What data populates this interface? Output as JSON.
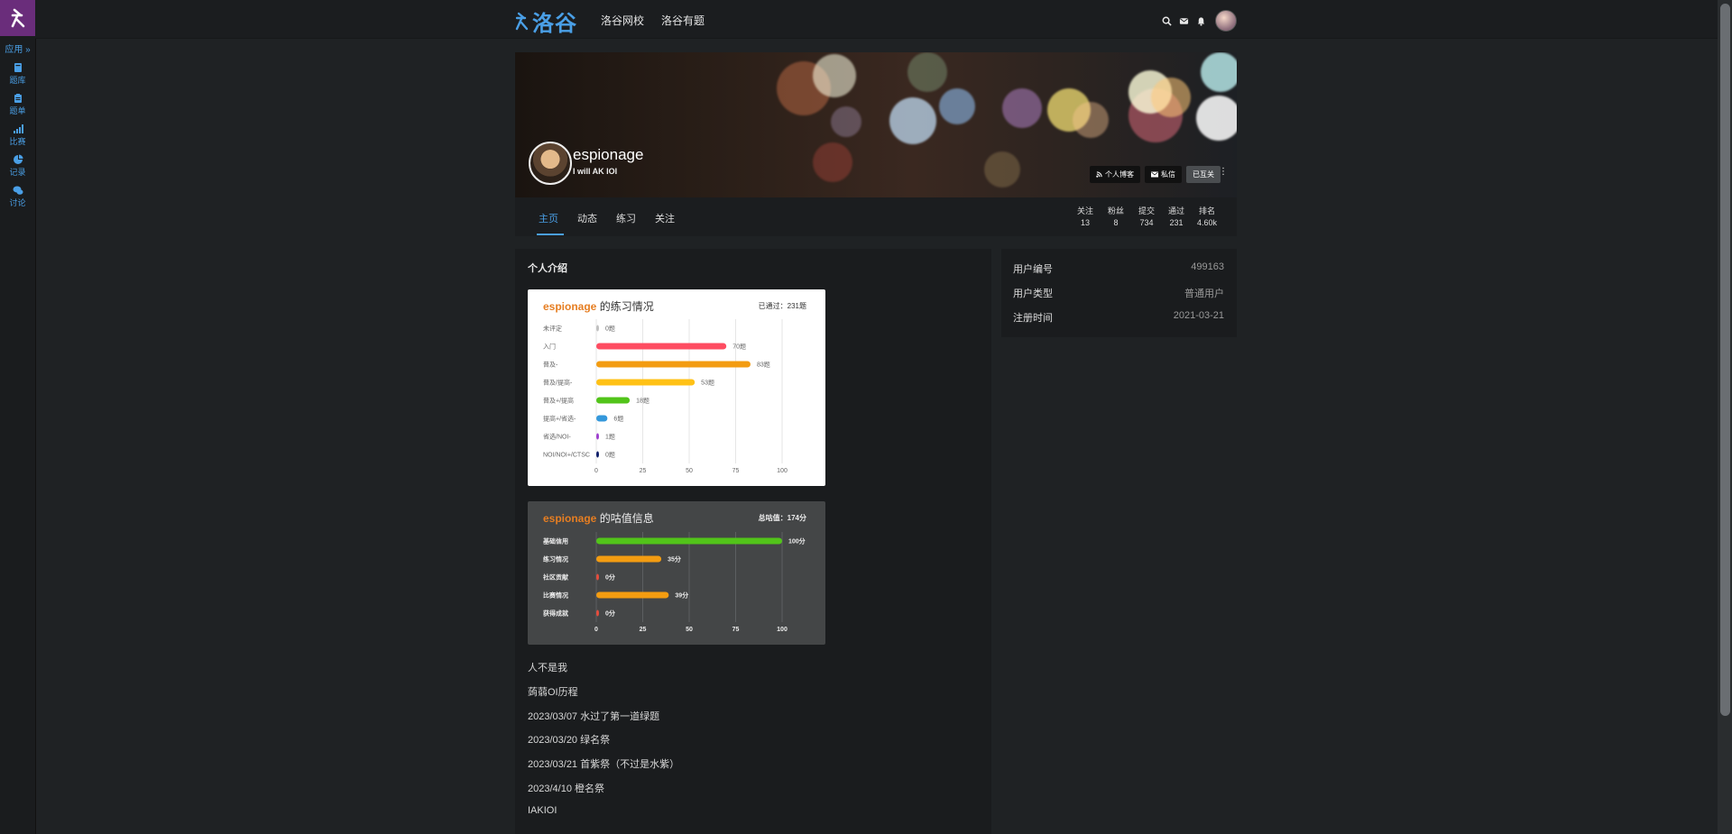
{
  "rail": {
    "apps_label": "应用 »",
    "items": [
      {
        "label": "题库",
        "icon": "book-icon"
      },
      {
        "label": "题单",
        "icon": "clipboard-icon"
      },
      {
        "label": "比赛",
        "icon": "signal-bars-icon"
      },
      {
        "label": "记录",
        "icon": "pie-chart-icon"
      },
      {
        "label": "讨论",
        "icon": "chat-bubbles-icon"
      }
    ]
  },
  "topbar": {
    "brand": "洛谷",
    "nav": [
      "洛谷网校",
      "洛谷有题"
    ],
    "icons": [
      "search-icon",
      "mail-icon",
      "bell-icon"
    ]
  },
  "profile": {
    "username": "espionage",
    "signature": "I will AK IOI",
    "buttons": {
      "blog": "个人博客",
      "message": "私信",
      "follow": "已互关"
    },
    "more": "⋮"
  },
  "tabs": [
    "主页",
    "动态",
    "练习",
    "关注"
  ],
  "stats": [
    {
      "label": "关注",
      "value": "13"
    },
    {
      "label": "粉丝",
      "value": "8"
    },
    {
      "label": "提交",
      "value": "734"
    },
    {
      "label": "通过",
      "value": "231"
    },
    {
      "label": "排名",
      "value": "4.60k"
    }
  ],
  "main": {
    "section_title": "个人介绍",
    "practice_card": {
      "user": "espionage",
      "title": "的练习情况",
      "summary": "已通过：231题"
    },
    "score_card": {
      "user": "espionage",
      "title": "的咕值信息",
      "summary": "总咕值：174分"
    },
    "intro_lines": [
      "人不是我",
      "蒟蒻OI历程",
      "2023/03/07 水过了第一道绿题",
      "2023/03/20 绿名祭",
      "2023/03/21 首紫祭（不过是水紫）",
      "2023/4/10 橙名祭",
      "IAKIOI"
    ]
  },
  "side": {
    "rows": [
      {
        "label": "用户编号",
        "value": "499163"
      },
      {
        "label": "用户类型",
        "value": "普通用户"
      },
      {
        "label": "注册时间",
        "value": "2021-03-21"
      }
    ]
  },
  "chart_data": [
    {
      "type": "bar",
      "orientation": "horizontal",
      "categories": [
        "未评定",
        "入门",
        "普及-",
        "普及/提高-",
        "普及+/提高",
        "提高+/省选-",
        "省选/NOI-",
        "NOI/NOI+/CTSC"
      ],
      "values": [
        0,
        70,
        83,
        53,
        18,
        6,
        1,
        0
      ],
      "value_labels": [
        "0题",
        "70题",
        "83题",
        "53题",
        "18题",
        "6题",
        "1题",
        "0题"
      ],
      "colors": [
        "#bfbfbf",
        "#fe4c61",
        "#f39c11",
        "#ffc116",
        "#52c41a",
        "#3498db",
        "#9d3dcf",
        "#0e1d69"
      ],
      "xlim": [
        0,
        100
      ],
      "xticks": [
        "0",
        "25",
        "50",
        "75",
        "100"
      ],
      "grid": true
    },
    {
      "type": "bar",
      "orientation": "horizontal",
      "categories": [
        "基础信用",
        "练习情况",
        "社区贡献",
        "比赛情况",
        "获得成就"
      ],
      "values": [
        100,
        35,
        0,
        39,
        0
      ],
      "value_labels": [
        "100分",
        "35分",
        "0分",
        "39分",
        "0分"
      ],
      "colors": [
        "#52c41a",
        "#f39c11",
        "#e74c3c",
        "#f39c11",
        "#e74c3c"
      ],
      "xlim": [
        0,
        100
      ],
      "xticks": [
        "0",
        "25",
        "50",
        "75",
        "100"
      ],
      "grid": true
    }
  ]
}
